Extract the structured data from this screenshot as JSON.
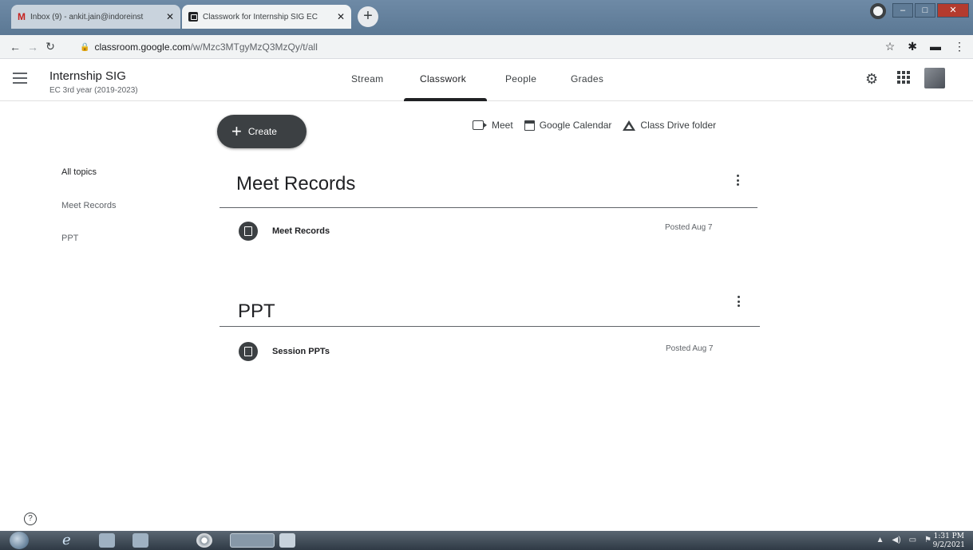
{
  "browser": {
    "tabs": [
      {
        "title": "Inbox (9) - ankit.jain@indoreinst",
        "active": false
      },
      {
        "title": "Classwork for Internship SIG EC",
        "active": true
      }
    ],
    "url_domain": "classroom.google.com",
    "url_path": "/w/Mzc3MTgyMzQ3MzQy/t/all",
    "new_tab_label": "+"
  },
  "header": {
    "class_name": "Internship SIG",
    "class_section": "EC 3rd year (2019-2023)",
    "nav_tabs": [
      "Stream",
      "Classwork",
      "People",
      "Grades"
    ],
    "active_tab": "Classwork"
  },
  "toolbar": {
    "create_label": "Create",
    "meet_label": "Meet",
    "calendar_label": "Google Calendar",
    "drive_label": "Class Drive folder"
  },
  "sidebar": {
    "topics": [
      "All topics",
      "Meet Records",
      "PPT"
    ],
    "active_topic": "All topics"
  },
  "topics": [
    {
      "title": "Meet Records",
      "items": [
        {
          "name": "Meet Records",
          "posted": "Posted Aug 7"
        }
      ]
    },
    {
      "title": "PPT",
      "items": [
        {
          "name": "Session PPTs",
          "posted": "Posted Aug 7"
        }
      ]
    }
  ],
  "taskbar": {
    "time": "1:31 PM",
    "date": "9/2/2021"
  },
  "colors": {
    "accent_dark": "#3c4043",
    "title_text": "#202124",
    "muted_text": "#5f6368"
  }
}
